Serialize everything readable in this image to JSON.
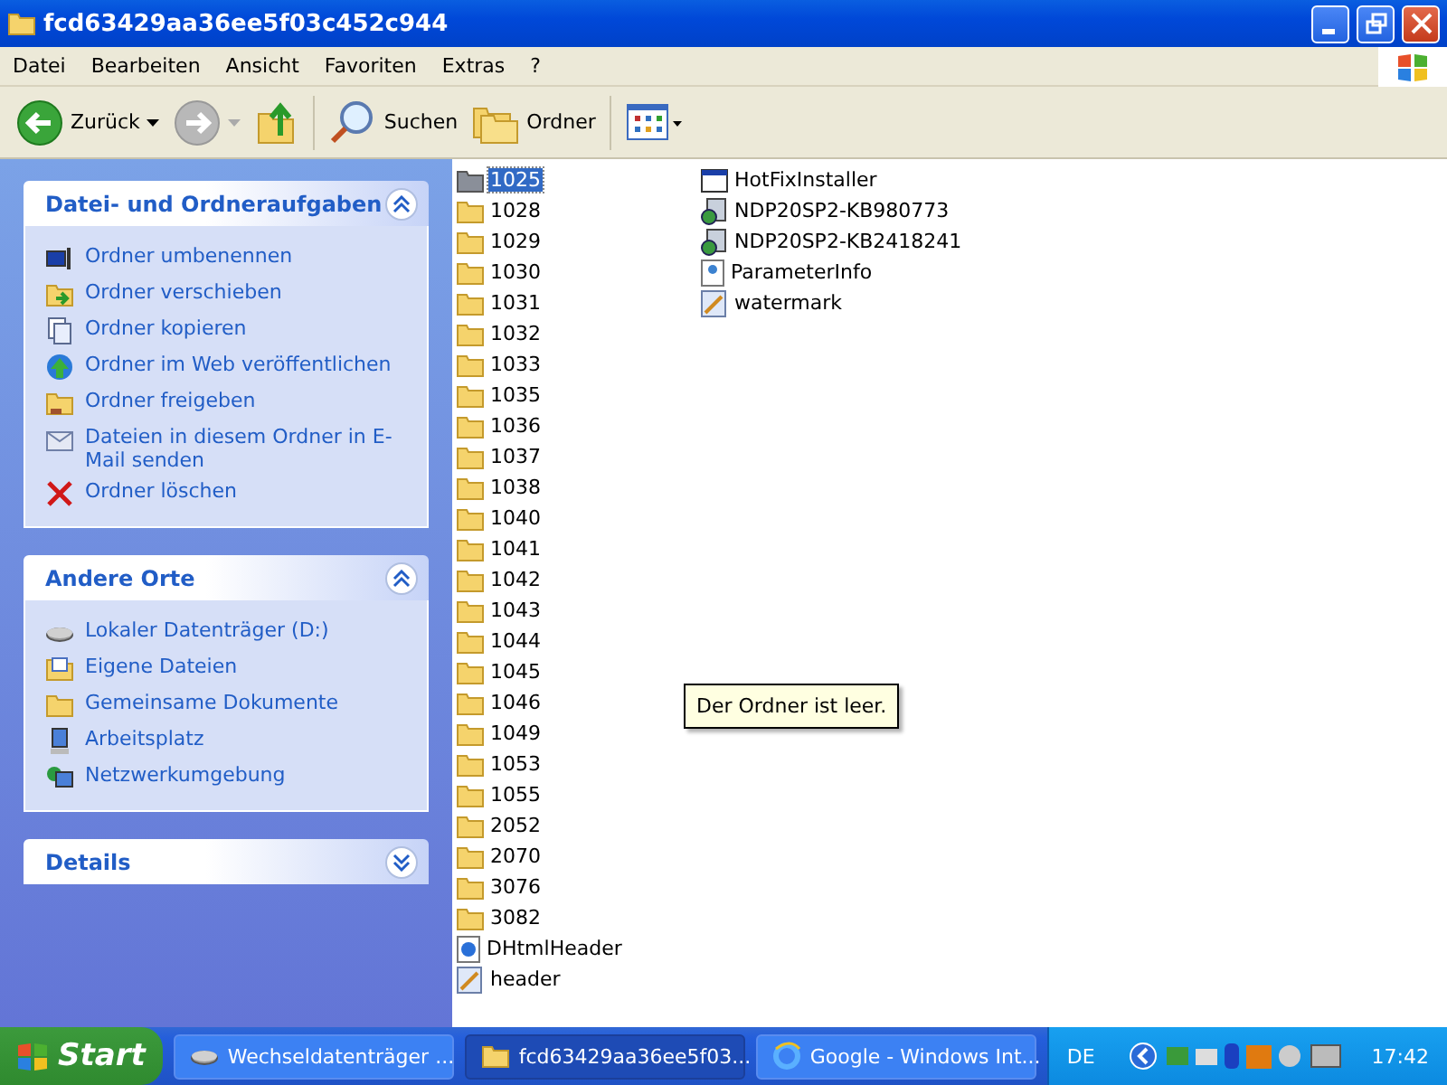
{
  "window": {
    "title": "fcd63429aa36ee5f03c452c944"
  },
  "menu": [
    "Datei",
    "Bearbeiten",
    "Ansicht",
    "Favoriten",
    "Extras",
    "?"
  ],
  "toolbar": [
    {
      "kind": "back",
      "label": "Zurück",
      "disabled": false
    },
    {
      "kind": "forward",
      "disabled": true
    },
    {
      "kind": "up",
      "disabled": false
    },
    {
      "kind": "search",
      "label": "Suchen",
      "disabled": false
    },
    {
      "kind": "folders",
      "label": "Ordner",
      "disabled": false
    },
    {
      "kind": "views",
      "disabled": false
    }
  ],
  "panels": [
    {
      "title": "Datei- und Ordneraufgaben",
      "expanded": true,
      "items": [
        {
          "kind": "rename",
          "label": "Ordner umbenennen"
        },
        {
          "kind": "move",
          "label": "Ordner verschieben"
        },
        {
          "kind": "copy",
          "label": "Ordner kopieren"
        },
        {
          "kind": "web",
          "label": "Ordner im Web veröffentlichen"
        },
        {
          "kind": "share",
          "label": "Ordner freigeben"
        },
        {
          "kind": "mail",
          "label": "Dateien in diesem Ordner in E-Mail senden"
        },
        {
          "kind": "delete",
          "label": "Ordner löschen"
        }
      ]
    },
    {
      "title": "Andere Orte",
      "expanded": true,
      "items": [
        {
          "kind": "drive",
          "label": "Lokaler Datenträger (D:)"
        },
        {
          "kind": "docs",
          "label": "Eigene Dateien"
        },
        {
          "kind": "folder",
          "label": "Gemeinsame Dokumente"
        },
        {
          "kind": "computer",
          "label": "Arbeitsplatz"
        },
        {
          "kind": "network",
          "label": "Netzwerkumgebung"
        }
      ]
    },
    {
      "title": "Details",
      "expanded": false
    }
  ],
  "files": [
    [
      {
        "name": "1025",
        "kind": "folder",
        "selected": true
      },
      {
        "name": "1028",
        "kind": "folder",
        "selected": false
      },
      {
        "name": "1029",
        "kind": "folder",
        "selected": false
      },
      {
        "name": "1030",
        "kind": "folder",
        "selected": false
      },
      {
        "name": "1031",
        "kind": "folder",
        "selected": false
      },
      {
        "name": "1032",
        "kind": "folder",
        "selected": false
      },
      {
        "name": "1033",
        "kind": "folder",
        "selected": false
      },
      {
        "name": "1035",
        "kind": "folder",
        "selected": false
      },
      {
        "name": "1036",
        "kind": "folder",
        "selected": false
      },
      {
        "name": "1037",
        "kind": "folder",
        "selected": false
      },
      {
        "name": "1038",
        "kind": "folder",
        "selected": false
      },
      {
        "name": "1040",
        "kind": "folder",
        "selected": false
      },
      {
        "name": "1041",
        "kind": "folder",
        "selected": false
      },
      {
        "name": "1042",
        "kind": "folder",
        "selected": false
      },
      {
        "name": "1043",
        "kind": "folder",
        "selected": false
      },
      {
        "name": "1044",
        "kind": "folder",
        "selected": false
      },
      {
        "name": "1045",
        "kind": "folder",
        "selected": false
      },
      {
        "name": "1046",
        "kind": "folder",
        "selected": false
      },
      {
        "name": "1049",
        "kind": "folder",
        "selected": false
      },
      {
        "name": "1053",
        "kind": "folder",
        "selected": false
      },
      {
        "name": "1055",
        "kind": "folder",
        "selected": false
      },
      {
        "name": "2052",
        "kind": "folder",
        "selected": false
      },
      {
        "name": "2070",
        "kind": "folder",
        "selected": false
      },
      {
        "name": "3076",
        "kind": "folder",
        "selected": false
      },
      {
        "name": "3082",
        "kind": "folder",
        "selected": false
      },
      {
        "name": "DHtmlHeader",
        "kind": "html",
        "selected": false
      },
      {
        "name": "header",
        "kind": "image",
        "selected": false
      }
    ],
    [
      {
        "name": "HotFixInstaller",
        "kind": "app",
        "selected": false
      },
      {
        "name": "NDP20SP2-KB980773",
        "kind": "setup",
        "selected": false
      },
      {
        "name": "NDP20SP2-KB2418241",
        "kind": "setup",
        "selected": false
      },
      {
        "name": "ParameterInfo",
        "kind": "xml",
        "selected": false
      },
      {
        "name": "watermark",
        "kind": "image",
        "selected": false
      }
    ]
  ],
  "tooltip": "Der Ordner ist leer.",
  "taskbar": {
    "start": "Start",
    "tasks": [
      {
        "kind": "drive",
        "label": "Wechseldatenträger ...",
        "selected": false
      },
      {
        "kind": "folder",
        "label": "fcd63429aa36ee5f03...",
        "selected": true
      },
      {
        "kind": "ie",
        "label": "Google - Windows Int...",
        "selected": false
      }
    ],
    "language": "DE",
    "clock": "17:42"
  }
}
